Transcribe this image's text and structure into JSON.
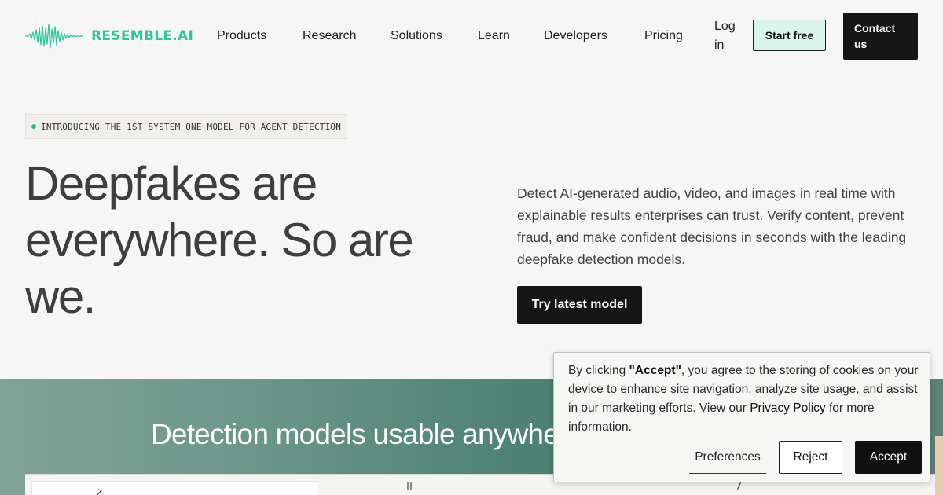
{
  "header": {
    "logo_text": "RESEMBLE.AI",
    "logo_icon": "waveform-icon",
    "nav": [
      {
        "label": "Products"
      },
      {
        "label": "Research"
      },
      {
        "label": "Solutions"
      },
      {
        "label": "Learn"
      },
      {
        "label": "Developers"
      },
      {
        "label": "Pricing"
      }
    ],
    "login_label": "Log in",
    "start_free_label": "Start free",
    "contact_label": "Contact us"
  },
  "hero": {
    "badge": "INTRODUCING THE 1ST SYSTEM ONE MODEL FOR AGENT DETECTION",
    "title": "Deepfakes are everywhere. So are we.",
    "description": "Detect AI-generated audio, video, and images in real time with explainable results enterprises can trust. Verify content, prevent fraud, and make confident decisions in seconds with the leading deepfake detection models.",
    "cta_label": "Try latest model"
  },
  "band": {
    "title": "Detection models usable anywhere"
  },
  "cookie": {
    "text_prefix": "By clicking ",
    "text_bold": "\"Accept\"",
    "text_middle": ", you agree to the storing of cookies on your device to enhance site navigation, analyze site usage, and assist in our marketing efforts. View our ",
    "link_label": "Privacy Policy",
    "text_suffix": " for more information.",
    "preferences_label": "Preferences",
    "reject_label": "Reject",
    "accept_label": "Accept"
  },
  "colors": {
    "brand": "#2fc79a",
    "start_free_bg": "#d9f5ea",
    "dark": "#161616",
    "band": "#4e8274"
  }
}
